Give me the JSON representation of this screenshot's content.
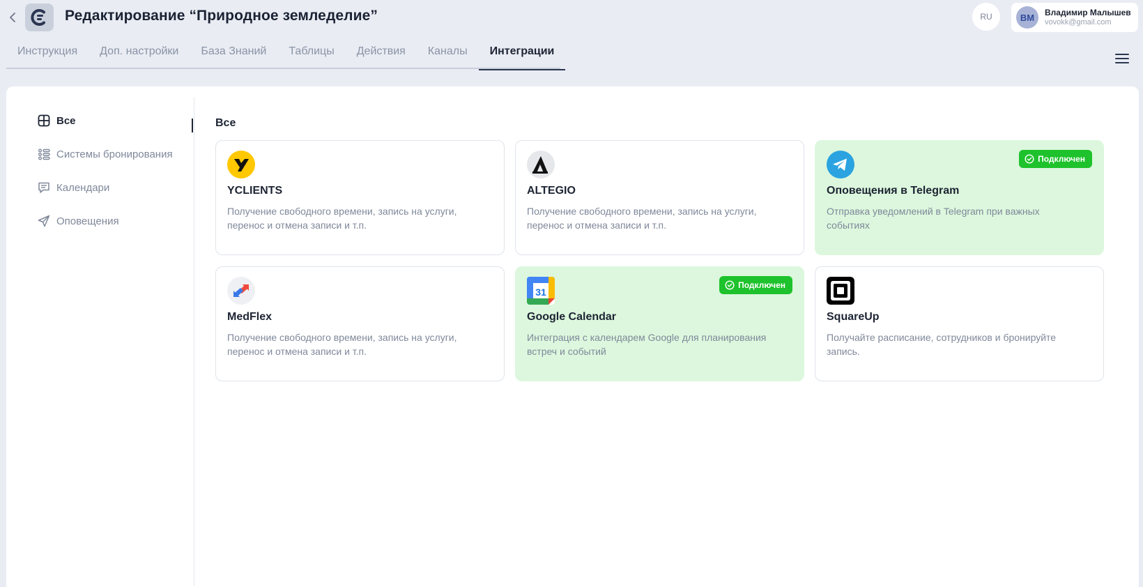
{
  "header": {
    "title": "Редактирование “Природное земледелие”",
    "lang": "RU",
    "user": {
      "initials": "ВМ",
      "name": "Владимир Малышев",
      "email": "vovokk@gmail.com"
    }
  },
  "tabs": [
    {
      "label": "Инструкция"
    },
    {
      "label": "Доп. настройки"
    },
    {
      "label": "База Знаний"
    },
    {
      "label": "Таблицы"
    },
    {
      "label": "Действия"
    },
    {
      "label": "Каналы"
    },
    {
      "label": "Интеграции",
      "active": true
    }
  ],
  "sidebar": {
    "items": [
      {
        "label": "Все",
        "icon": "grid-icon",
        "active": true
      },
      {
        "label": "Системы бронирования",
        "icon": "list-icon"
      },
      {
        "label": "Календари",
        "icon": "message-icon"
      },
      {
        "label": "Оповещения",
        "icon": "send-icon"
      }
    ]
  },
  "main": {
    "section_title": "Все",
    "badge_label": "Подключен",
    "cards": [
      {
        "title": "YCLIENTS",
        "description": "Получение свободного времени, запись на услуги, перенос и отмена записи и т.п.",
        "connected": false,
        "icon": "yclients-logo"
      },
      {
        "title": "ALTEGIO",
        "description": "Получение свободного времени, запись на услуги, перенос и отмена записи и т.п.",
        "connected": false,
        "icon": "altegio-logo"
      },
      {
        "title": "Оповещения в Telegram",
        "description": "Отправка уведомлений в Telegram при важных событиях",
        "connected": true,
        "icon": "telegram-logo"
      },
      {
        "title": "MedFlex",
        "description": "Получение свободного времени, запись на услуги, перенос и отмена записи и т.п.",
        "connected": false,
        "icon": "medflex-logo"
      },
      {
        "title": "Google Calendar",
        "description": "Интеграция с календарем Google для планирования встреч и событий",
        "connected": true,
        "icon": "google-calendar-logo"
      },
      {
        "title": "SquareUp",
        "description": "Получайте расписание, сотрудников и бронируйте запись.",
        "connected": false,
        "icon": "squareup-logo"
      }
    ]
  },
  "colors": {
    "background": "#e9ecf3",
    "connected_card": "#dcf7dd",
    "badge": "#1ec22c",
    "active_text": "#1d2433",
    "muted_text": "#7f889a"
  }
}
